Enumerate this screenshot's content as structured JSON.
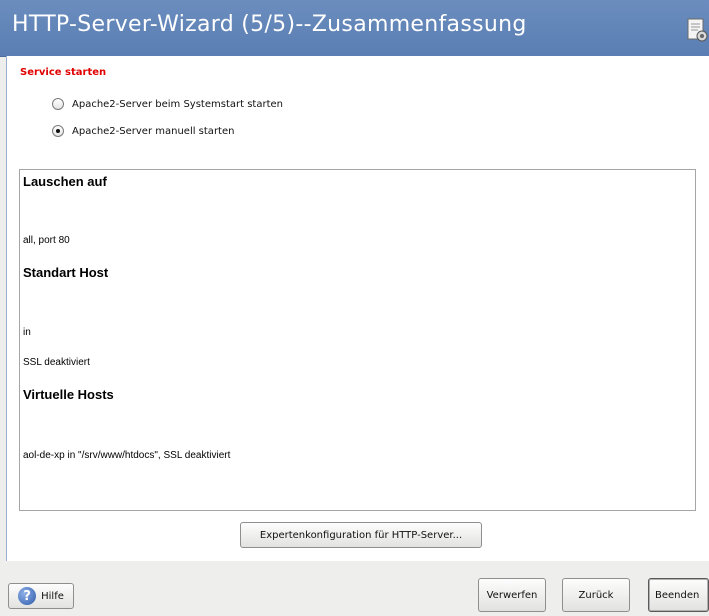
{
  "window": {
    "title": "HTTP-Server-Wizard (5/5)--Zusammenfassung",
    "icon": "document-settings-icon"
  },
  "service": {
    "heading": "Service starten",
    "options": [
      {
        "label": "Apache2-Server beim Systemstart starten",
        "checked": false
      },
      {
        "label": "Apache2-Server manuell starten",
        "checked": true
      }
    ]
  },
  "summary": {
    "sections": [
      {
        "heading": "Lauschen auf",
        "lines": [
          "all, port 80"
        ]
      },
      {
        "heading": "Standart Host",
        "lines": [
          " in",
          "SSL deaktiviert"
        ]
      },
      {
        "heading": "Virtuelle Hosts",
        "lines": [
          "aol-de-xp in \"/srv/www/htdocs\", SSL deaktiviert"
        ]
      }
    ]
  },
  "buttons": {
    "expert": "Expertenkonfiguration für HTTP-Server...",
    "help": "Hilfe",
    "discard": "Verwerfen",
    "back": "Zurück",
    "finish": "Beenden"
  },
  "colors": {
    "titlebar": "#5a7eb3",
    "heading_red": "#e00000",
    "background": "#eeeeec"
  }
}
